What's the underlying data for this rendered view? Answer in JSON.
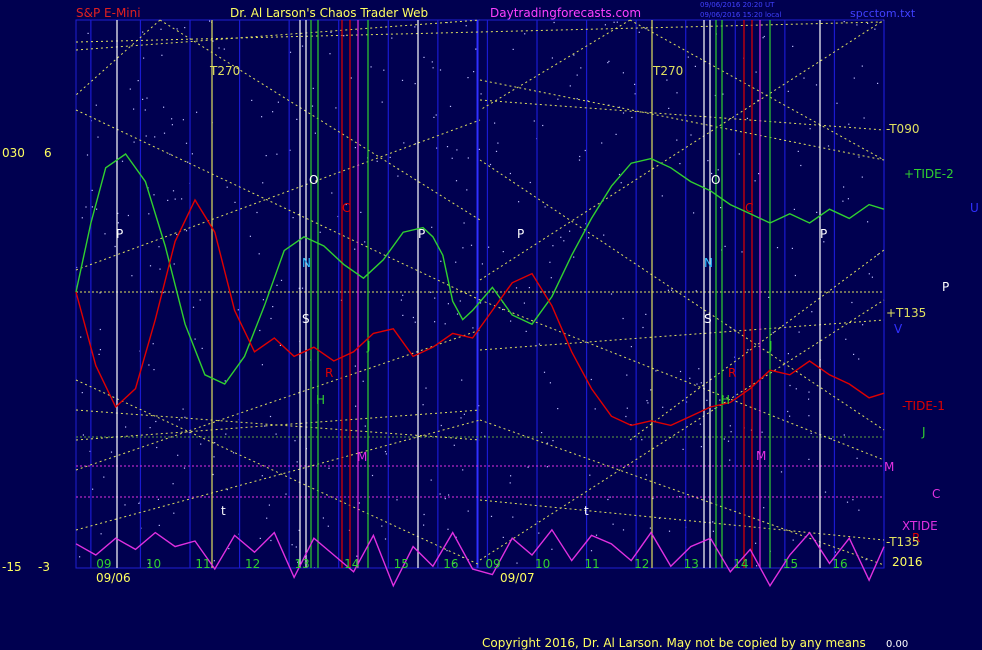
{
  "header": {
    "symbol": "S&P E-Mini",
    "title": "Dr. Al Larson's Chaos Trader Web",
    "site": "Daytradingforecasts.com",
    "stamp1": "09/06/2016 20:20 UT",
    "stamp2": "09/06/2016 15:20 local",
    "file": "spcctom.txt"
  },
  "footer": {
    "copyright": "Copyright 2016, Dr. Al Larson. May not be copied by any means",
    "value": "0.00"
  },
  "colors": {
    "background": "#000050",
    "tide1": "#e00000",
    "tide2": "#30d030",
    "xtide": "#e030e0",
    "gann": "#e0e060",
    "grid": "#2020c0"
  },
  "chart_data": {
    "type": "line",
    "axes": {
      "left_labels": [
        {
          "text": "030",
          "level": "upper"
        },
        {
          "text": "6",
          "level": "upper"
        },
        {
          "text": "-15",
          "level": "lower"
        },
        {
          "text": "-3",
          "level": "lower"
        }
      ],
      "hour_ticks_day1": [
        "09",
        "10",
        "11",
        "12",
        "13",
        "14",
        "15",
        "16"
      ],
      "hour_ticks_day2": [
        "09",
        "10",
        "11",
        "12",
        "13",
        "14",
        "15",
        "16"
      ],
      "date_labels": [
        "09/06",
        "09/07"
      ],
      "year_label": "2016"
    },
    "right_labels": [
      {
        "text": "-T090",
        "color": "#e0e060"
      },
      {
        "text": "+TIDE-2",
        "color": "#30d030"
      },
      {
        "text": "U",
        "color": "#3030ff"
      },
      {
        "text": "P",
        "color": "#ffffff"
      },
      {
        "text": "+T135",
        "color": "#e0e060"
      },
      {
        "text": "V",
        "color": "#3030ff"
      },
      {
        "text": "-TIDE-1",
        "color": "#e00000"
      },
      {
        "text": "J",
        "color": "#30d030"
      },
      {
        "text": "M",
        "color": "#e030e0"
      },
      {
        "text": "C",
        "color": "#e030e0"
      },
      {
        "text": "XTIDE",
        "color": "#e030e0"
      },
      {
        "text": "R",
        "color": "#e00000"
      },
      {
        "text": "-T135",
        "color": "#e0e060"
      }
    ],
    "vertical_markers": [
      {
        "label": "T270",
        "color": "#e0e060"
      },
      {
        "label": "T270",
        "color": "#e0e060"
      }
    ],
    "planet_labels": [
      "P",
      "O",
      "C",
      "N",
      "S",
      "J",
      "R",
      "H",
      "M",
      "t",
      "P",
      "P",
      "O",
      "C",
      "N",
      "S",
      "J",
      "R",
      "H",
      "M",
      "t",
      "P"
    ],
    "series": [
      {
        "name": "+TIDE-2",
        "color": "#30d030",
        "x": [
          0,
          0.3,
          0.6,
          1.0,
          1.4,
          1.8,
          2.2,
          2.6,
          3.0,
          3.4,
          3.8,
          4.2,
          4.6,
          5.0,
          5.4,
          5.8,
          6.2,
          6.6,
          7.0,
          7.2,
          7.4,
          7.6,
          7.8,
          8.0,
          8.4,
          8.8,
          9.2,
          9.6,
          10.0,
          10.4,
          10.8,
          11.2,
          11.6,
          12.0,
          12.4,
          12.8,
          13.2,
          13.6,
          14.0,
          14.4,
          14.8,
          15.2,
          15.6,
          16.0,
          16.3
        ],
        "y": [
          0.0,
          3.0,
          5.4,
          6.0,
          4.8,
          2.0,
          -1.4,
          -3.6,
          -4.0,
          -2.8,
          -0.6,
          1.8,
          2.4,
          2.0,
          1.2,
          0.6,
          1.4,
          2.6,
          2.8,
          2.4,
          1.6,
          -0.4,
          -1.2,
          -0.8,
          0.2,
          -1.0,
          -1.4,
          -0.2,
          1.6,
          3.2,
          4.6,
          5.6,
          5.8,
          5.4,
          4.8,
          4.4,
          3.8,
          3.4,
          3.0,
          3.4,
          3.0,
          3.6,
          3.2,
          3.8,
          3.6
        ]
      },
      {
        "name": "-TIDE-1",
        "color": "#e00000",
        "x": [
          0,
          0.4,
          0.8,
          1.2,
          1.6,
          2.0,
          2.4,
          2.8,
          3.2,
          3.6,
          4.0,
          4.4,
          4.8,
          5.2,
          5.6,
          6.0,
          6.4,
          6.8,
          7.2,
          7.6,
          8.0,
          8.4,
          8.8,
          9.2,
          9.6,
          10.0,
          10.4,
          10.8,
          11.2,
          11.6,
          12.0,
          12.4,
          12.8,
          13.2,
          13.6,
          14.0,
          14.4,
          14.8,
          15.2,
          15.6,
          16.0,
          16.3
        ],
        "y": [
          0.0,
          -3.2,
          -5.0,
          -4.2,
          -1.2,
          2.2,
          4.0,
          2.6,
          -0.8,
          -2.6,
          -2.0,
          -2.8,
          -2.4,
          -3.0,
          -2.6,
          -1.8,
          -1.6,
          -2.8,
          -2.4,
          -1.8,
          -2.0,
          -0.8,
          0.4,
          0.8,
          -0.6,
          -2.6,
          -4.2,
          -5.4,
          -5.8,
          -5.6,
          -5.8,
          -5.4,
          -5.0,
          -4.8,
          -4.2,
          -3.4,
          -3.6,
          -3.0,
          -3.6,
          -4.0,
          -4.6,
          -4.4
        ]
      },
      {
        "name": "XTIDE",
        "color": "#e030e0",
        "x": [
          0,
          0.4,
          0.8,
          1.2,
          1.6,
          2.0,
          2.4,
          2.8,
          3.2,
          3.6,
          4.0,
          4.4,
          4.8,
          5.2,
          5.6,
          6.0,
          6.4,
          6.8,
          7.2,
          7.6,
          8.0,
          8.4,
          8.8,
          9.2,
          9.6,
          10.0,
          10.4,
          10.8,
          11.2,
          11.6,
          12.0,
          12.4,
          12.8,
          13.2,
          13.6,
          14.0,
          14.4,
          14.8,
          15.2,
          15.6,
          16.0,
          16.3
        ],
        "y": [
          -13.8,
          -13.0,
          -14.2,
          -13.4,
          -14.6,
          -13.6,
          -14.0,
          -12.0,
          -14.4,
          -13.2,
          -14.6,
          -11.4,
          -14.2,
          -13.0,
          -11.8,
          -14.4,
          -10.8,
          -13.6,
          -12.2,
          -14.6,
          -12.0,
          -11.6,
          -14.2,
          -13.0,
          -14.8,
          -12.6,
          -14.4,
          -13.8,
          -12.6,
          -14.6,
          -12.2,
          -13.6,
          -14.2,
          -11.8,
          -13.4,
          -10.8,
          -13.0,
          -14.6,
          -12.4,
          -14.2,
          -11.2,
          -13.6
        ]
      }
    ]
  }
}
